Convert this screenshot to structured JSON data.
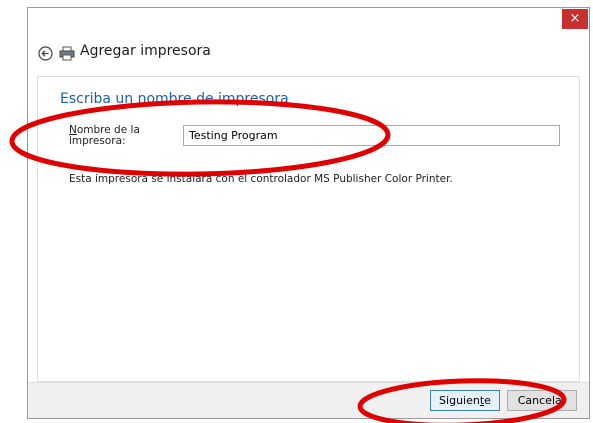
{
  "window": {
    "close_label": "×"
  },
  "header": {
    "title": "Agregar impresora",
    "back_icon": "back-arrow-icon",
    "printer_icon": "printer-icon"
  },
  "main": {
    "heading": "Escriba un nombre de impresora",
    "field_label_prefix": "N",
    "field_label_rest": "ombre de la",
    "field_label_line2": "impresora:",
    "field_value": "Testing Program",
    "info_text": "Esta impresora se instalará con el controlador MS Publisher Color Printer."
  },
  "footer": {
    "next_label_pre": "Siguien",
    "next_label_mnemonic": "t",
    "next_label_post": "e",
    "cancel_label": "Cancelar"
  },
  "annotations": {
    "color": "#e00000"
  },
  "colors": {
    "heading": "#1e5eb5",
    "close": "#c7302c",
    "input_border": "#7eb4ea",
    "footer_bg": "#f0f0f0"
  }
}
